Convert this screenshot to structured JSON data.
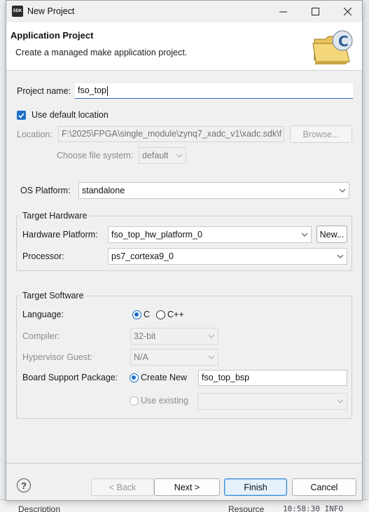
{
  "window": {
    "app_icon_text": "SDK",
    "title": "New Project",
    "controls": {
      "minimize": "—",
      "maximize": "☐",
      "close": "✕"
    }
  },
  "header": {
    "title": "Application Project",
    "description": "Create a managed make application project."
  },
  "project": {
    "name_label": "Project name:",
    "name_value": "fso_top",
    "use_default_location_label": "Use default location",
    "use_default_location_checked": true,
    "location_label": "Location:",
    "location_value": "F:\\2025\\FPGA\\single_module\\zynq7_xadc_v1\\xadc.sdk\\f",
    "browse_label": "Browse...",
    "file_system_label": "Choose file system:",
    "file_system_value": "default"
  },
  "os_platform": {
    "label": "OS Platform:",
    "value": "standalone"
  },
  "target_hardware": {
    "title": "Target Hardware",
    "hardware_platform_label": "Hardware Platform:",
    "hardware_platform_value": "fso_top_hw_platform_0",
    "new_button": "New...",
    "processor_label": "Processor:",
    "processor_value": "ps7_cortexa9_0"
  },
  "target_software": {
    "title": "Target Software",
    "language_label": "Language:",
    "language_options": [
      "C",
      "C++"
    ],
    "language_selected": "C",
    "compiler_label": "Compiler:",
    "compiler_value": "32-bit",
    "hypervisor_label": "Hypervisor Guest:",
    "hypervisor_value": "N/A",
    "bsp_label": "Board Support Package:",
    "bsp_create_new_label": "Create New",
    "bsp_create_new_value": "fso_top_bsp",
    "bsp_use_existing_label": "Use existing",
    "bsp_selected": "Create New"
  },
  "footer": {
    "help": "?",
    "back": "< Back",
    "next": "Next >",
    "finish": "Finish",
    "cancel": "Cancel"
  },
  "background": {
    "col_description": "Description",
    "col_resource": "Resource",
    "log_text": "10:58:30 INFO"
  },
  "colors": {
    "accent": "#1f6fc5",
    "dialog_bg": "#f0f0f0",
    "header_bg": "#ffffff"
  }
}
